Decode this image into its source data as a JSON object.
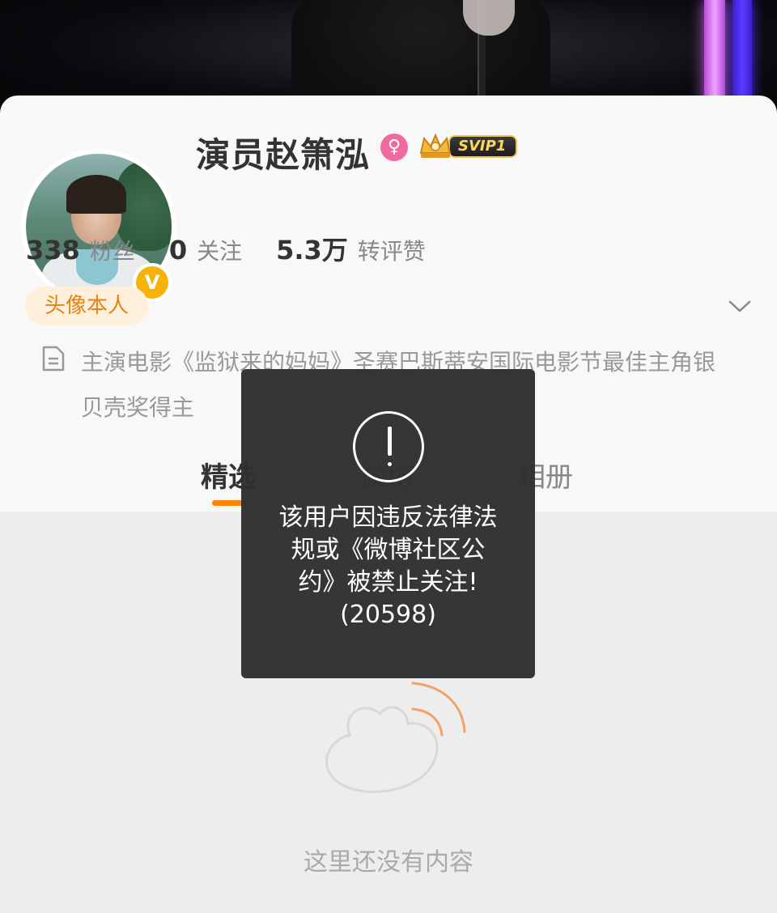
{
  "profile": {
    "name": "演员赵箫泓",
    "gender_icon": "female-icon",
    "vip_label": "SVIP1",
    "verified_badge": "V"
  },
  "stats": [
    {
      "value": "338",
      "label": "粉丝"
    },
    {
      "value": "0",
      "label": "关注"
    },
    {
      "value": "5.3万",
      "label": "转评赞"
    }
  ],
  "tag_chip": "头像本人",
  "bio": "主演电影《监狱来的妈妈》圣赛巴斯蒂安国际电影节最佳主角银贝壳奖得主",
  "tabs": [
    {
      "label": "精选",
      "active": true
    },
    {
      "label": "微博",
      "active": false
    },
    {
      "label": "相册",
      "active": false
    }
  ],
  "empty_state": {
    "text": "这里还没有内容"
  },
  "toast": {
    "icon": "exclamation-icon",
    "message": "该用户因违反法律法\n规或《微博社区公\n约》被禁止关注!\n(20598)"
  },
  "colors": {
    "accent": "#ff8200",
    "verified": "#f6b30a",
    "chip_text": "#e0851c",
    "chip_bg": "#fff0db"
  }
}
